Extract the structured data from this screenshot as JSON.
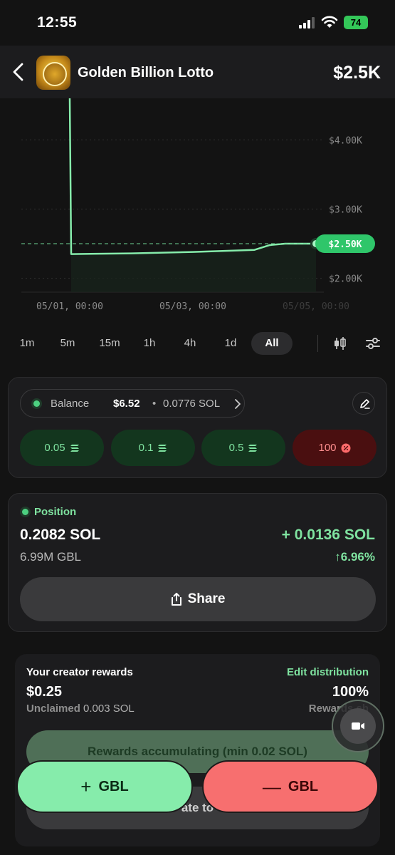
{
  "status_bar": {
    "time": "12:55",
    "battery": "74"
  },
  "header": {
    "title": "Golden Billion Lotto",
    "price": "$2.5K"
  },
  "chart_data": {
    "type": "line",
    "x": [
      "05/01, 00:00",
      "05/01, 01:00",
      "05/02, 00:00",
      "05/03, 00:00",
      "05/04, 00:00",
      "05/04, 06:00",
      "05/04, 12:00",
      "05/05, 00:00"
    ],
    "series": [
      {
        "values": [
          4600,
          2350,
          2360,
          2380,
          2410,
          2480,
          2500,
          2500
        ]
      }
    ],
    "yticks": [
      "$4.00K",
      "$3.00K",
      "$2.00K"
    ],
    "xticks": [
      "05/01, 00:00",
      "05/03, 00:00",
      "05/05, 00:00"
    ],
    "ylim": [
      1800,
      4600
    ],
    "current_label": "$2.50K",
    "line_color": "#86ecab",
    "grid": "horizontal dotted"
  },
  "timeframes": {
    "items": [
      "1m",
      "5m",
      "15m",
      "1h",
      "4h",
      "1d",
      "All"
    ],
    "active": "All"
  },
  "trade": {
    "balance_label": "Balance",
    "balance_usd": "$6.52",
    "separator": "•",
    "balance_sol": "0.0776 SOL",
    "amounts": [
      "0.05",
      "0.1",
      "0.5"
    ],
    "percent_amount": "100"
  },
  "position": {
    "label": "Position",
    "sol": "0.2082 SOL",
    "tokens": "6.99M GBL",
    "pnl": "+ 0.0136 SOL",
    "pnl_pct": "↑6.96%",
    "share_label": "Share"
  },
  "rewards": {
    "title": "Your creator rewards",
    "edit_link": "Edit distribution",
    "amount": "$0.25",
    "percent": "100%",
    "unclaimed_label": "Unclaimed",
    "unclaimed_value": "0.003 SOL",
    "share_label": "Rewards sh",
    "accumulating": "Rewards accumulating (min 0.02 SOL)",
    "donate": "ate to"
  },
  "actions": {
    "buy": "GBL",
    "sell": "GBL"
  },
  "colors": {
    "green": "#86ecab",
    "red": "#f76f6f",
    "accent": "#7fe3a0"
  }
}
